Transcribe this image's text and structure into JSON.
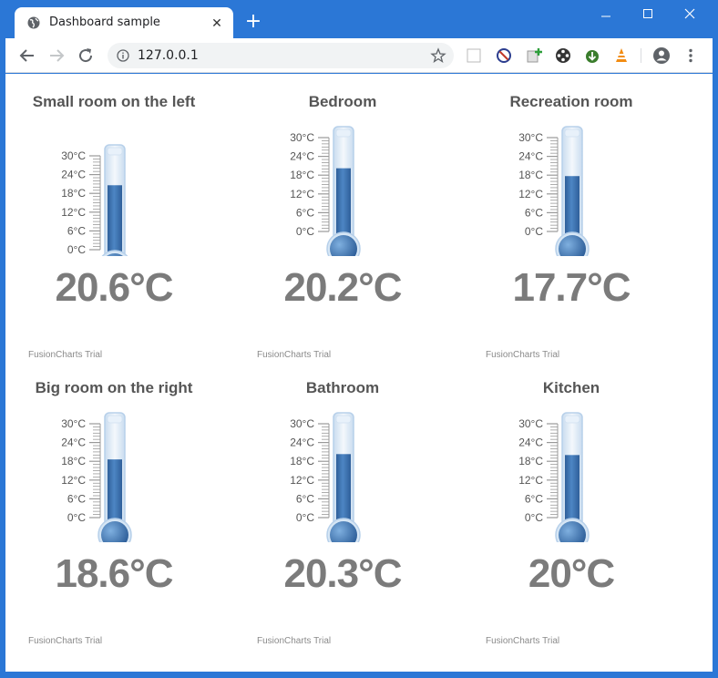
{
  "browser": {
    "tab_title": "Dashboard sample",
    "url": "127.0.0.1"
  },
  "scale": {
    "min": 0,
    "max": 30,
    "ticks": [
      "30°C",
      "24°C",
      "18°C",
      "12°C",
      "6°C",
      "0°C"
    ]
  },
  "trial_label": "FusionCharts Trial",
  "colors": {
    "fill": "#3f77b5",
    "tube": "#e6f0fa",
    "title": "#555555",
    "reading": "#7b7b7b"
  },
  "rooms": [
    {
      "title": "Small room on the left",
      "value": 20.6,
      "display": "20.6°C"
    },
    {
      "title": "Bedroom",
      "value": 20.2,
      "display": "20.2°C"
    },
    {
      "title": "Recreation room",
      "value": 17.7,
      "display": "17.7°C"
    },
    {
      "title": "Big room on the right",
      "value": 18.6,
      "display": "18.6°C"
    },
    {
      "title": "Bathroom",
      "value": 20.3,
      "display": "20.3°C"
    },
    {
      "title": "Kitchen",
      "value": 20,
      "display": "20°C"
    }
  ]
}
